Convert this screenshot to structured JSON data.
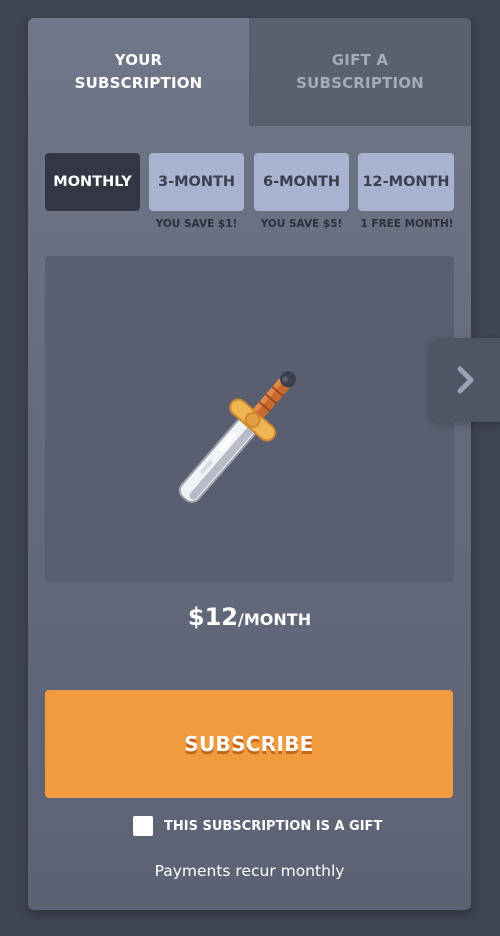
{
  "tabs": [
    {
      "label": "YOUR\nSUBSCRIPTION",
      "active": true
    },
    {
      "label": "GIFT A\nSUBSCRIPTION",
      "active": false
    }
  ],
  "plans": [
    {
      "label": "MONTHLY",
      "note": "",
      "selected": true
    },
    {
      "label": "3-MONTH",
      "note": "YOU SAVE $1!",
      "selected": false
    },
    {
      "label": "6-MONTH",
      "note": "YOU SAVE $5!",
      "selected": false
    },
    {
      "label": "12-MONTH",
      "note": "1 FREE MONTH!",
      "selected": false
    }
  ],
  "showcase": {
    "item_icon": "sword-icon",
    "next_icon": "chevron-right-icon"
  },
  "price": {
    "amount": "$12",
    "period": "/MONTH"
  },
  "subscribe": {
    "label": "SUBSCRIBE"
  },
  "gift": {
    "label": "THIS SUBSCRIPTION IS A GIFT",
    "checked": false
  },
  "recur_text": "Payments recur monthly",
  "colors": {
    "background": "#3f4452",
    "card": "#666d7f",
    "selected_plan": "#333744",
    "plan": "#a9b2cf",
    "subscribe": "#f19a3e"
  }
}
